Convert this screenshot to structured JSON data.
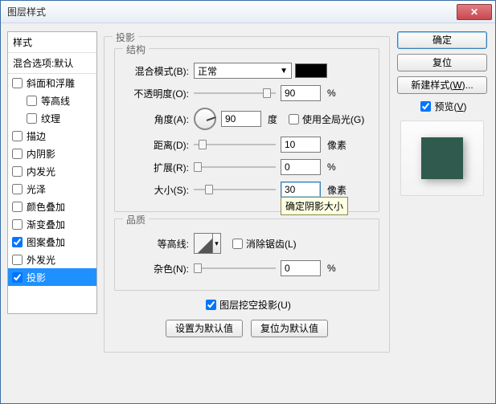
{
  "window": {
    "title": "图层样式"
  },
  "sidebar": {
    "header": "样式",
    "sub": "混合选项:默认",
    "items": [
      {
        "label": "斜面和浮雕",
        "checked": false
      },
      {
        "label": "等高线",
        "checked": false,
        "indent": true
      },
      {
        "label": "纹理",
        "checked": false,
        "indent": true
      },
      {
        "label": "描边",
        "checked": false
      },
      {
        "label": "内阴影",
        "checked": false
      },
      {
        "label": "内发光",
        "checked": false
      },
      {
        "label": "光泽",
        "checked": false
      },
      {
        "label": "颜色叠加",
        "checked": false
      },
      {
        "label": "渐变叠加",
        "checked": false
      },
      {
        "label": "图案叠加",
        "checked": true
      },
      {
        "label": "外发光",
        "checked": false
      },
      {
        "label": "投影",
        "checked": true,
        "selected": true
      }
    ]
  },
  "buttons": {
    "ok": "确定",
    "cancel": "复位",
    "newstyle": "新建样式(W)...",
    "preview": "预览(V)"
  },
  "panel": {
    "title": "投影",
    "structure": {
      "group": "结构",
      "blend_label": "混合模式(B):",
      "blend_value": "正常",
      "opacity_label": "不透明度(O):",
      "opacity_value": "90",
      "opacity_unit": "%",
      "angle_label": "角度(A):",
      "angle_value": "90",
      "angle_unit": "度",
      "global_light": "使用全局光(G)",
      "distance_label": "距离(D):",
      "distance_value": "10",
      "distance_unit": "像素",
      "spread_label": "扩展(R):",
      "spread_value": "0",
      "spread_unit": "%",
      "size_label": "大小(S):",
      "size_value": "30",
      "size_unit": "像素"
    },
    "quality": {
      "group": "品质",
      "contour_label": "等高线:",
      "antialias": "消除锯齿(L)",
      "noise_label": "杂色(N):",
      "noise_value": "0",
      "noise_unit": "%"
    },
    "knockout": "图层挖空投影(U)",
    "set_default": "设置为默认值",
    "reset_default": "复位为默认值"
  },
  "tooltip": "确定阴影大小"
}
